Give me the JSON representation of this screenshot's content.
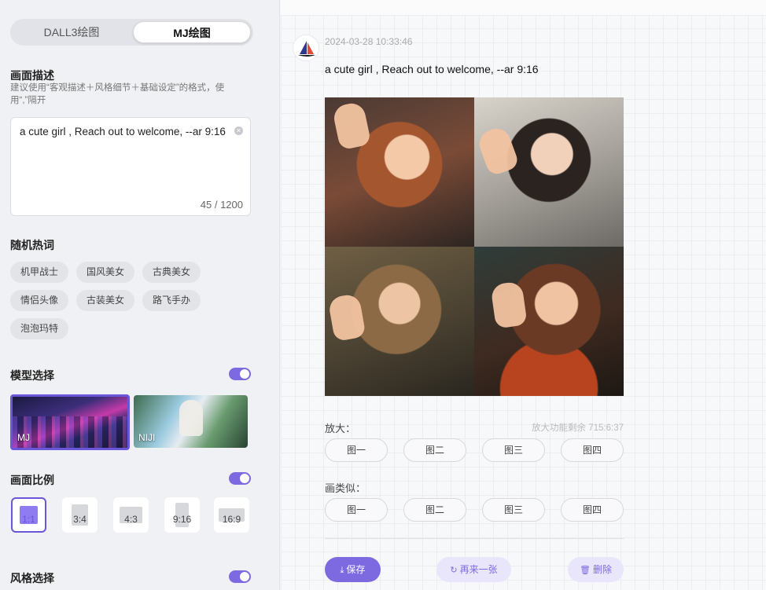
{
  "mode_switch": {
    "options": [
      "DALL3绘图",
      "MJ绘图"
    ],
    "selected": "MJ绘图"
  },
  "description": {
    "title": "画面描述",
    "hint": "建议使用“客观描述＋风格细节＋基础设定”的格式，使用“,”隔开",
    "value": "a cute girl , Reach out to welcome, --ar 9:16",
    "counter": "45 / 1200"
  },
  "hot_words": {
    "title": "随机热词",
    "tags": [
      "机甲战士",
      "国风美女",
      "古典美女",
      "情侣头像",
      "古装美女",
      "路飞手办",
      "泡泡玛特"
    ]
  },
  "model": {
    "title": "模型选择",
    "enabled": true,
    "options": [
      {
        "label": "MJ",
        "selected": true
      },
      {
        "label": "NIJI",
        "selected": false
      }
    ]
  },
  "ratio": {
    "title": "画面比例",
    "enabled": true,
    "options": [
      "1:1",
      "3:4",
      "4:3",
      "9:16",
      "16:9"
    ],
    "selected": "1:1"
  },
  "style": {
    "title": "风格选择",
    "enabled": true
  },
  "result": {
    "timestamp": "2024-03-28 10:33:46",
    "prompt": "a cute girl , Reach out to welcome, --ar 9:16",
    "upscale": {
      "title": "放大：",
      "remaining": "放大功能剩余 715:6:37",
      "buttons": [
        "图一",
        "图二",
        "图三",
        "图四"
      ]
    },
    "variation": {
      "title": "画类似：",
      "buttons": [
        "图一",
        "图二",
        "图三",
        "图四"
      ]
    },
    "actions": {
      "save": "保存",
      "again": "再来一张",
      "delete": "删除"
    }
  },
  "colors": {
    "accent": "#7d6ae0",
    "accent_light": "#e9e5fb"
  }
}
